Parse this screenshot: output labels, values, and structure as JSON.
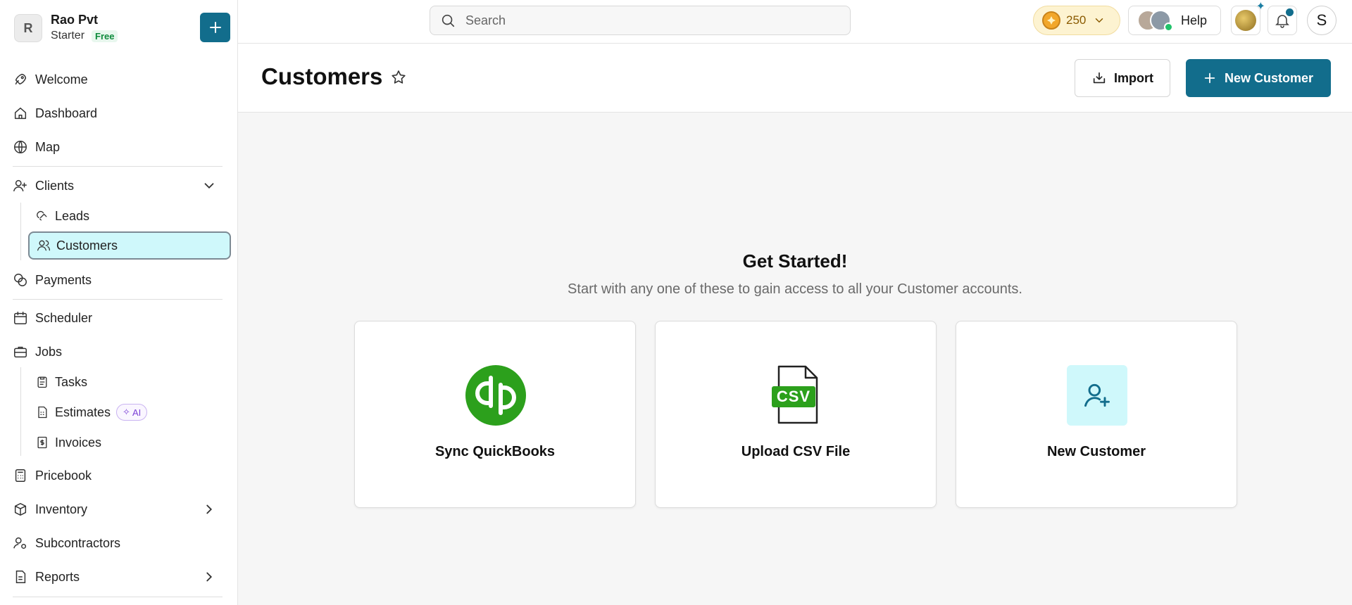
{
  "org": {
    "initial": "R",
    "name": "Rao Pvt",
    "plan": "Starter",
    "plan_badge": "Free"
  },
  "nav": {
    "welcome": "Welcome",
    "dashboard": "Dashboard",
    "map": "Map",
    "clients": "Clients",
    "leads": "Leads",
    "customers": "Customers",
    "payments": "Payments",
    "scheduler": "Scheduler",
    "jobs": "Jobs",
    "tasks": "Tasks",
    "estimates": "Estimates",
    "estimates_badge": "AI",
    "invoices": "Invoices",
    "pricebook": "Pricebook",
    "inventory": "Inventory",
    "subcontractors": "Subcontractors",
    "reports": "Reports"
  },
  "topbar": {
    "search_placeholder": "Search",
    "credits": "250",
    "help": "Help",
    "user_initial": "S"
  },
  "header": {
    "title": "Customers",
    "import_label": "Import",
    "new_label": "New Customer"
  },
  "main": {
    "title": "Get Started!",
    "subtitle": "Start with any one of these to gain access to all your Customer accounts.",
    "cards": [
      {
        "label": "Sync QuickBooks",
        "icon": "quickbooks-icon"
      },
      {
        "label": "Upload CSV File",
        "icon": "csv-file-icon",
        "icon_text": "CSV"
      },
      {
        "label": "New Customer",
        "icon": "user-plus-icon"
      }
    ]
  },
  "colors": {
    "primary": "#126d8c",
    "active_bg": "#cff8fb",
    "quickbooks": "#2ca01c"
  }
}
